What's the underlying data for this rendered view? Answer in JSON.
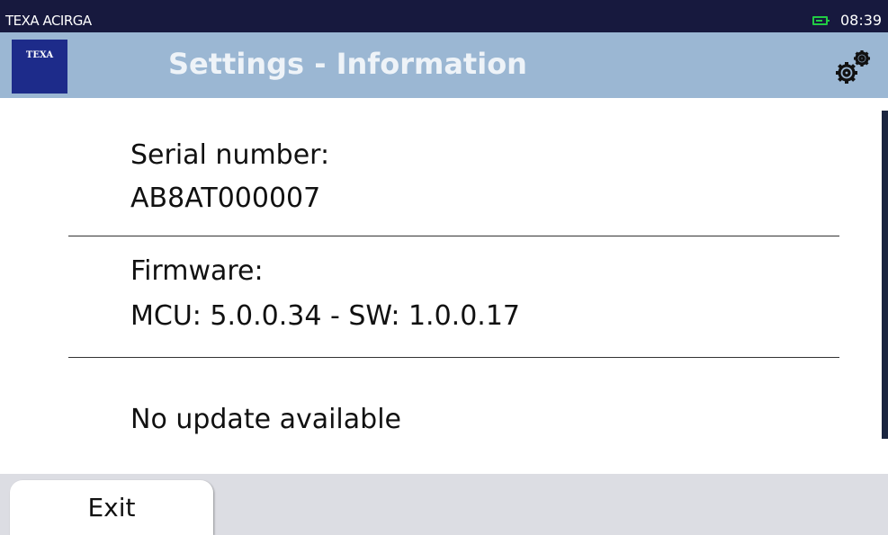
{
  "status_bar": {
    "device_name": "TEXA ACIRGA",
    "battery_icon": "battery-icon",
    "clock": "08:39"
  },
  "header": {
    "logo_text": "TEXA",
    "title": "Settings - Information",
    "settings_icon": "gears-icon"
  },
  "info": {
    "serial_label": "Serial number:",
    "serial_value": "AB8AT000007",
    "firmware_label": "Firmware:",
    "firmware_value": "MCU: 5.0.0.34 - SW: 1.0.0.17",
    "update_status": "No update available"
  },
  "footer": {
    "exit_label": "Exit"
  },
  "colors": {
    "status_bar_bg": "#17193e",
    "title_bar_bg": "#9bb7d3",
    "logo_bg": "#1d2b8a",
    "battery": "#22cc44",
    "bottom_bar_bg": "#dcdde3"
  }
}
